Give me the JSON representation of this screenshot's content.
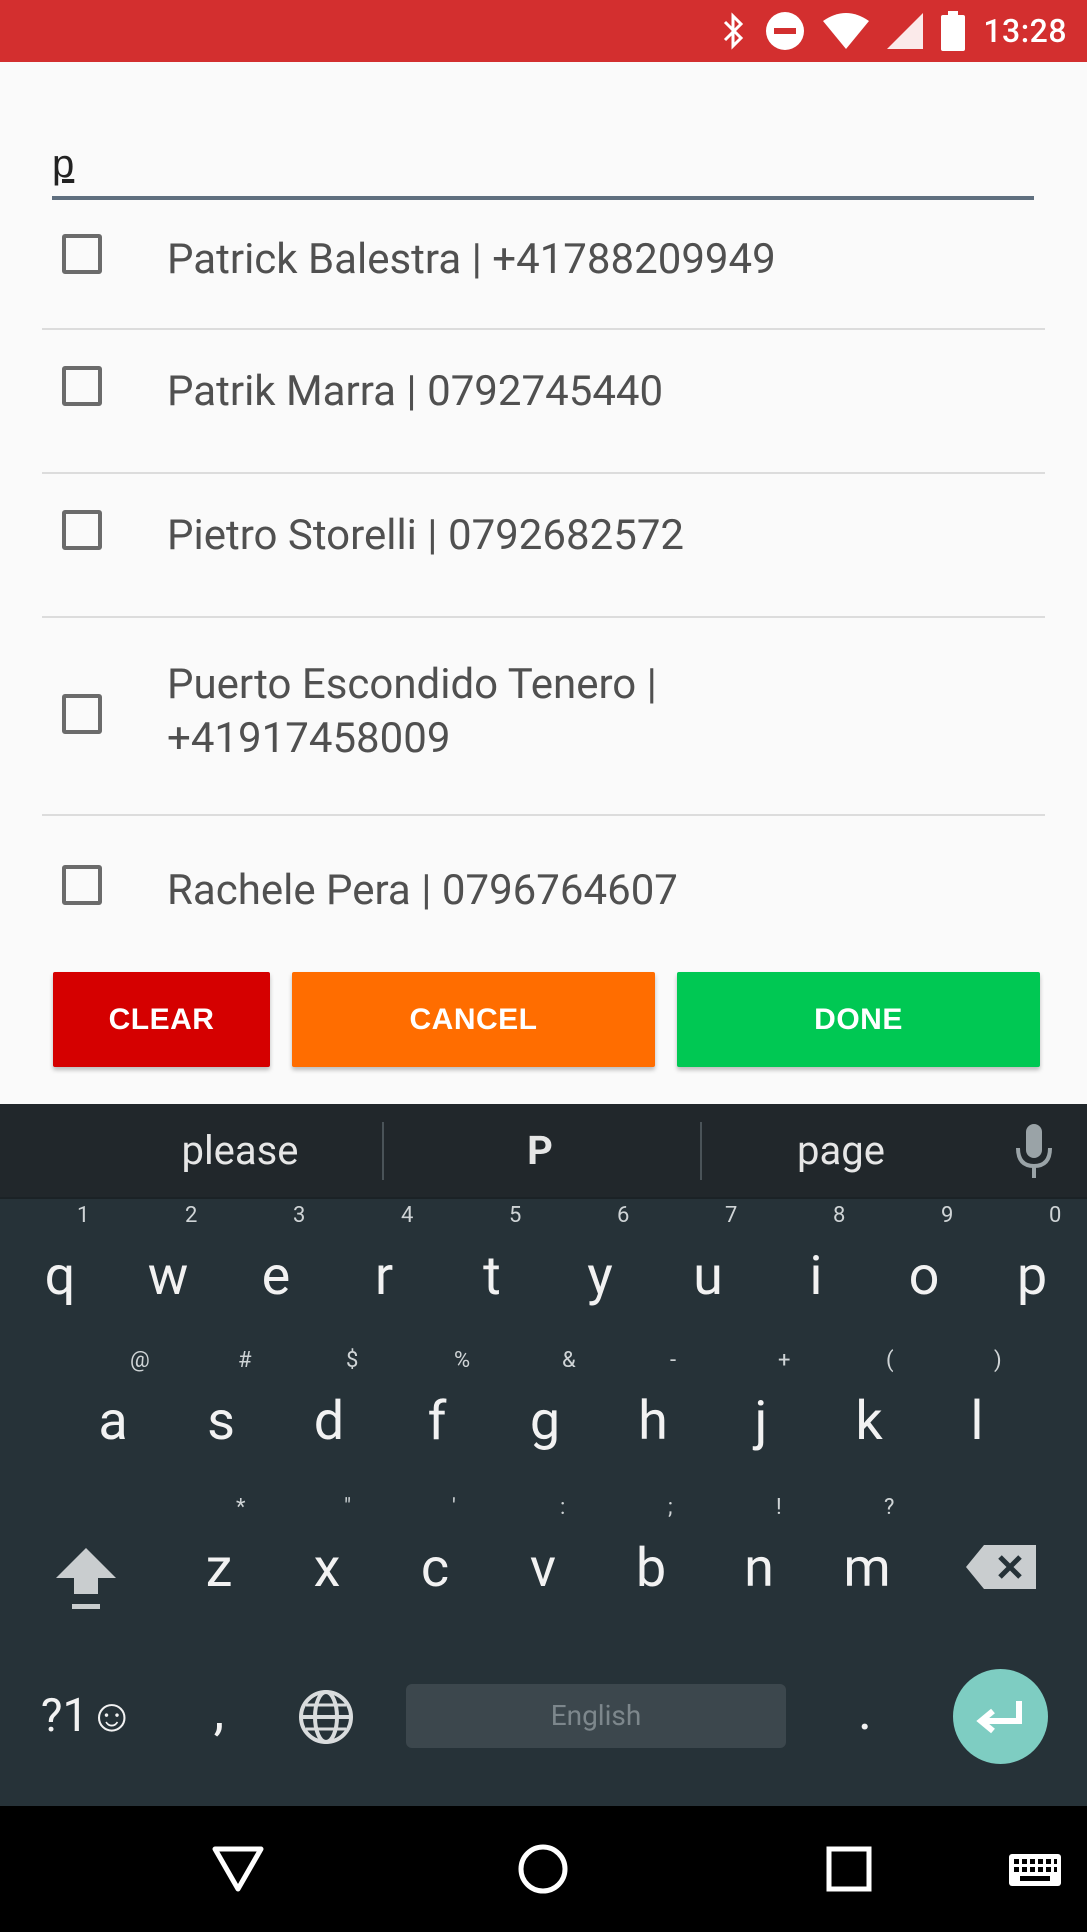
{
  "status_bar": {
    "time": "13:28"
  },
  "search": {
    "value": "p"
  },
  "contacts": [
    {
      "label": "Patrick Balestra |  +41788209949"
    },
    {
      "label": "Patrik Marra |  0792745440"
    },
    {
      "label": "Pietro Storelli |  0792682572"
    },
    {
      "label": "Puerto Escondido Tenero |  +41917458009"
    },
    {
      "label": "Rachele Pera |  0796764607"
    }
  ],
  "buttons": {
    "clear": "CLEAR",
    "cancel": "CANCEL",
    "done": "DONE"
  },
  "colors": {
    "status_bar": "#d32f2f",
    "clear": "#d50000",
    "cancel": "#ff6d00",
    "done": "#00c853",
    "enter": "#7ecdc2"
  },
  "keyboard": {
    "suggestions": [
      "please",
      "P",
      "page"
    ],
    "row1": [
      {
        "k": "q",
        "s": "1"
      },
      {
        "k": "w",
        "s": "2"
      },
      {
        "k": "e",
        "s": "3"
      },
      {
        "k": "r",
        "s": "4"
      },
      {
        "k": "t",
        "s": "5"
      },
      {
        "k": "y",
        "s": "6"
      },
      {
        "k": "u",
        "s": "7"
      },
      {
        "k": "i",
        "s": "8"
      },
      {
        "k": "o",
        "s": "9"
      },
      {
        "k": "p",
        "s": "0"
      }
    ],
    "row2": [
      {
        "k": "a",
        "s": "@"
      },
      {
        "k": "s",
        "s": "#"
      },
      {
        "k": "d",
        "s": "$"
      },
      {
        "k": "f",
        "s": "%"
      },
      {
        "k": "g",
        "s": "&"
      },
      {
        "k": "h",
        "s": "-"
      },
      {
        "k": "j",
        "s": "+"
      },
      {
        "k": "k",
        "s": "("
      },
      {
        "k": "l",
        "s": ")"
      }
    ],
    "row3": [
      {
        "k": "z",
        "s": "*"
      },
      {
        "k": "x",
        "s": "\""
      },
      {
        "k": "c",
        "s": "'"
      },
      {
        "k": "v",
        "s": ":"
      },
      {
        "k": "b",
        "s": ";"
      },
      {
        "k": "n",
        "s": "!"
      },
      {
        "k": "m",
        "s": "?"
      }
    ],
    "symbols_key": "?1☺",
    "comma": ",",
    "period": ".",
    "space_label": "English"
  }
}
